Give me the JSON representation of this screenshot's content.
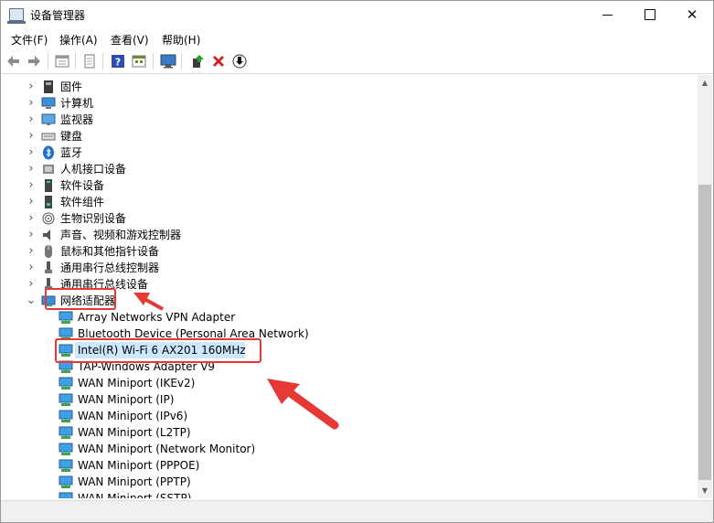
{
  "window": {
    "title": "设备管理器"
  },
  "menu": [
    "文件(F)",
    "操作(A)",
    "查看(V)",
    "帮助(H)"
  ],
  "tree": {
    "categories": [
      {
        "label": "固件",
        "icon": "firmware-icon"
      },
      {
        "label": "计算机",
        "icon": "computer-icon"
      },
      {
        "label": "监视器",
        "icon": "monitor-icon"
      },
      {
        "label": "键盘",
        "icon": "keyboard-icon"
      },
      {
        "label": "蓝牙",
        "icon": "bluetooth-icon"
      },
      {
        "label": "人机接口设备",
        "icon": "hid-icon"
      },
      {
        "label": "软件设备",
        "icon": "software-device-icon"
      },
      {
        "label": "软件组件",
        "icon": "software-component-icon"
      },
      {
        "label": "生物识别设备",
        "icon": "fingerprint-icon"
      },
      {
        "label": "声音、视频和游戏控制器",
        "icon": "speaker-icon"
      },
      {
        "label": "鼠标和其他指针设备",
        "icon": "mouse-icon"
      },
      {
        "label": "通用串行总线控制器",
        "icon": "usb-icon"
      },
      {
        "label": "通用串行总线设备",
        "icon": "usb-icon"
      },
      {
        "label": "网络适配器",
        "icon": "network-adapter-icon",
        "expanded": true
      }
    ],
    "network_adapters": [
      "Array Networks VPN Adapter",
      "Bluetooth Device (Personal Area Network)",
      "Intel(R) Wi-Fi 6 AX201 160MHz",
      "TAP-Windows Adapter V9",
      "WAN Miniport (IKEv2)",
      "WAN Miniport (IP)",
      "WAN Miniport (IPv6)",
      "WAN Miniport (L2TP)",
      "WAN Miniport (Network Monitor)",
      "WAN Miniport (PPPOE)",
      "WAN Miniport (PPTP)",
      "WAN Miniport (SSTP)"
    ],
    "selected_adapter": "Intel(R) Wi-Fi 6 AX201 160MHz"
  },
  "colors": {
    "annotation_red": "#e53935",
    "selection": "#cce8ff"
  }
}
